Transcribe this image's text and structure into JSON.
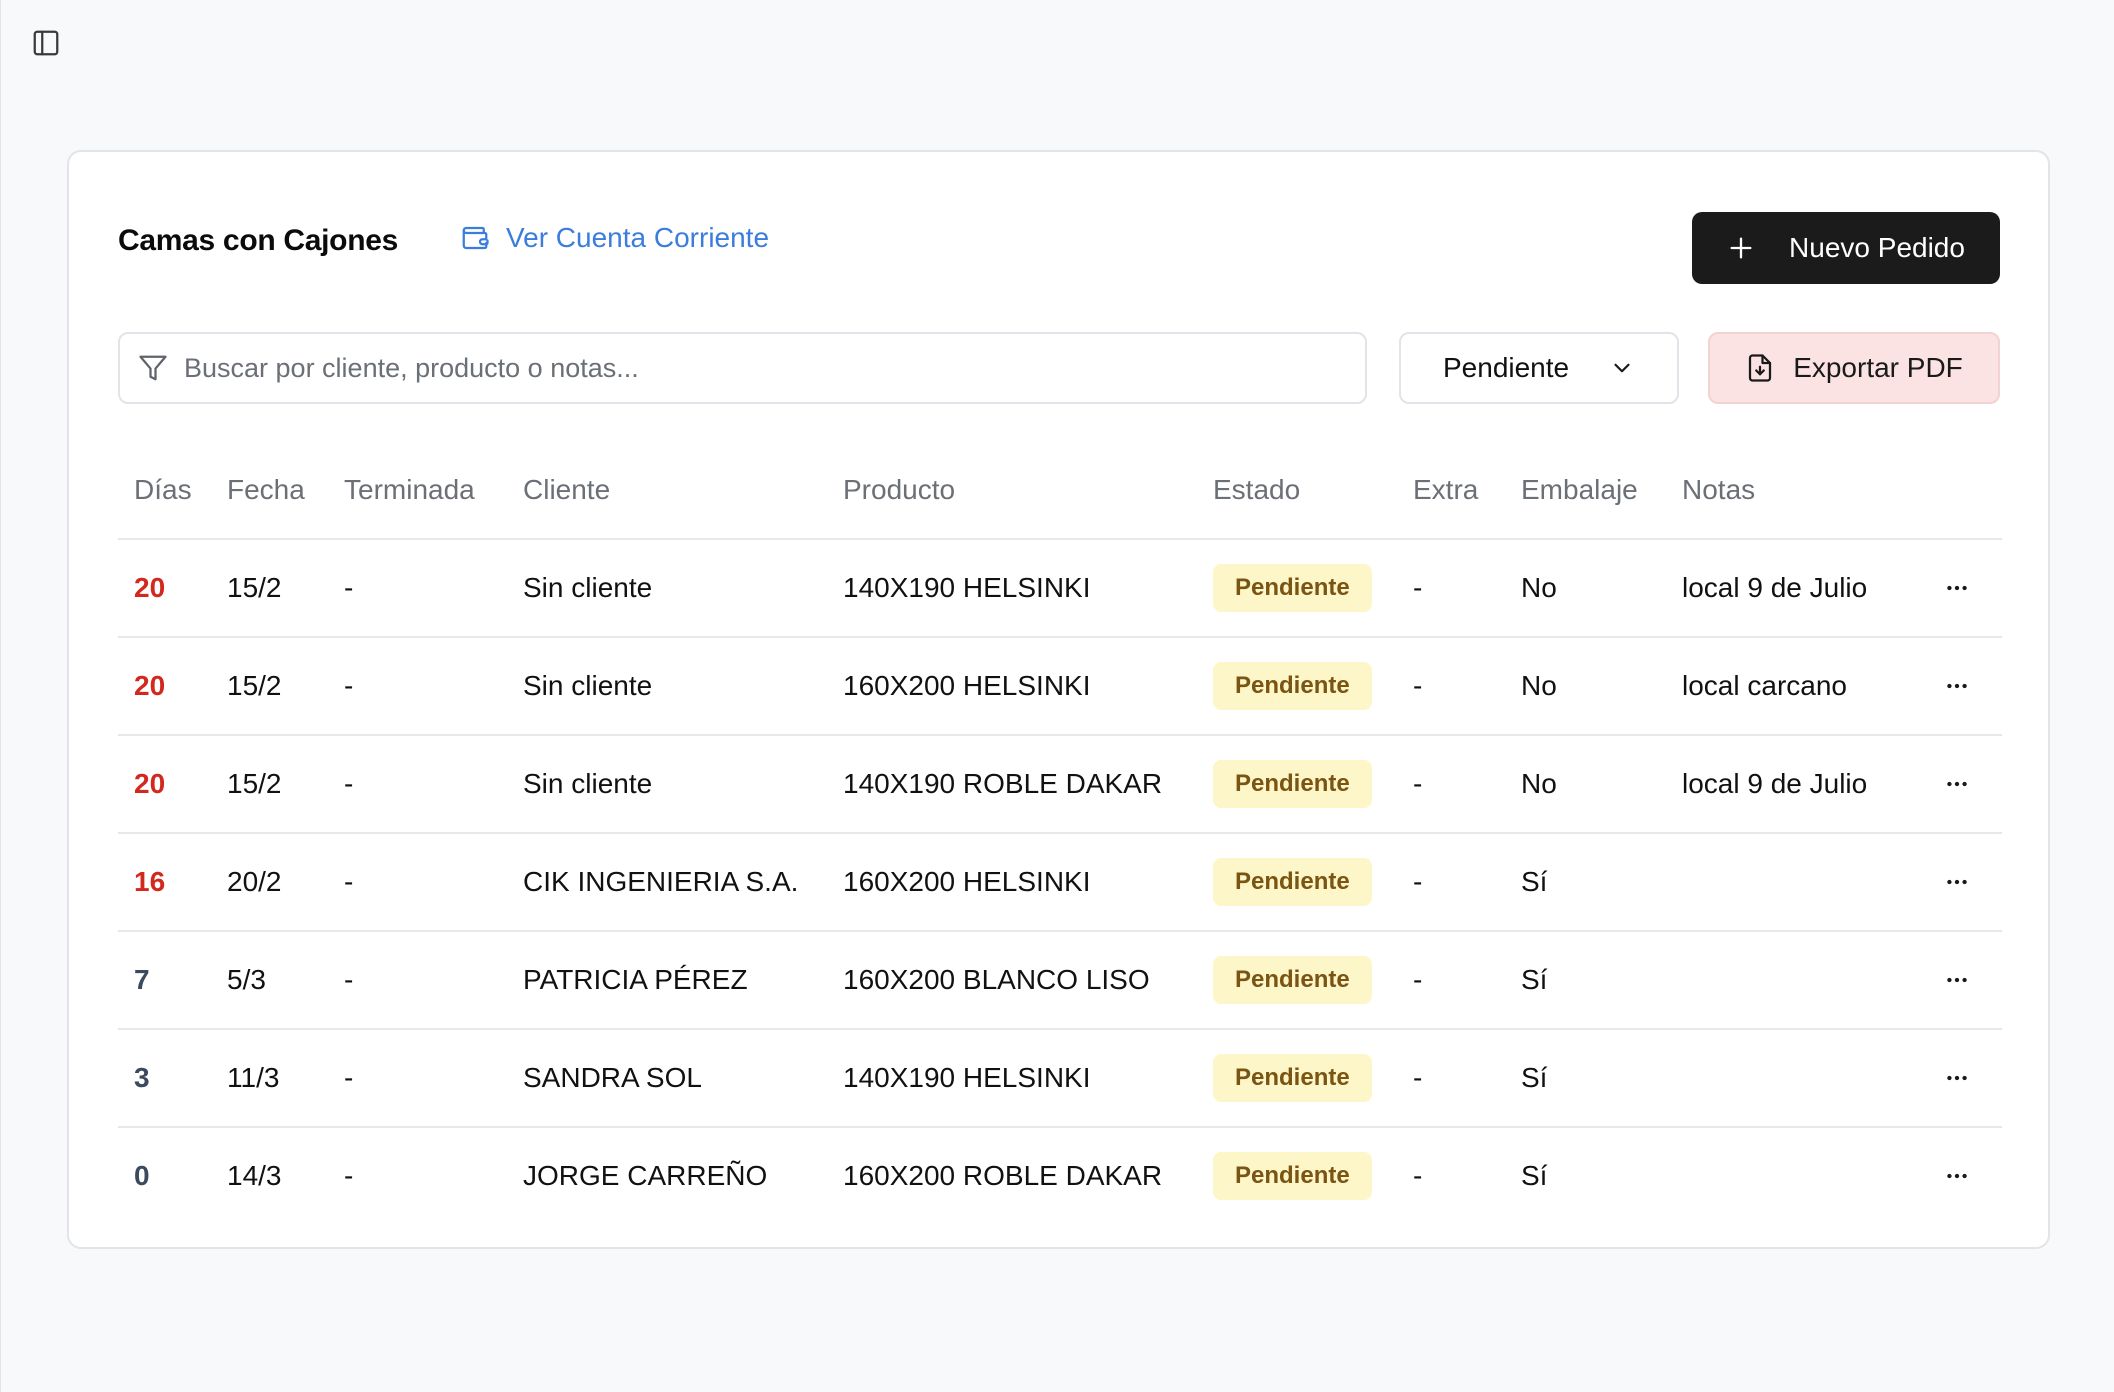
{
  "header": {
    "title": "Camas con Cajones",
    "account_link_label": "Ver Cuenta Corriente",
    "new_order_label": "Nuevo Pedido"
  },
  "filters": {
    "search_placeholder": "Buscar por cliente, producto o notas...",
    "search_value": "",
    "status_selected": "Pendiente",
    "export_label": "Exportar PDF"
  },
  "table": {
    "columns": [
      "Días",
      "Fecha",
      "Terminada",
      "Cliente",
      "Producto",
      "Estado",
      "Extra",
      "Embalaje",
      "Notas"
    ],
    "rows": [
      {
        "dias": "20",
        "fecha": "15/2",
        "terminada": "-",
        "cliente": "Sin cliente",
        "producto": "140X190 HELSINKI",
        "estado": "Pendiente",
        "extra": "-",
        "embalaje": "No",
        "notas": "local 9 de Julio",
        "urgent": true
      },
      {
        "dias": "20",
        "fecha": "15/2",
        "terminada": "-",
        "cliente": "Sin cliente",
        "producto": "160X200 HELSINKI",
        "estado": "Pendiente",
        "extra": "-",
        "embalaje": "No",
        "notas": "local carcano",
        "urgent": true
      },
      {
        "dias": "20",
        "fecha": "15/2",
        "terminada": "-",
        "cliente": "Sin cliente",
        "producto": "140X190 ROBLE DAKAR",
        "estado": "Pendiente",
        "extra": "-",
        "embalaje": "No",
        "notas": "local 9 de Julio",
        "urgent": true
      },
      {
        "dias": "16",
        "fecha": "20/2",
        "terminada": "-",
        "cliente": "CIK INGENIERIA S.A.",
        "producto": "160X200 HELSINKI",
        "estado": "Pendiente",
        "extra": "-",
        "embalaje": "Sí",
        "notas": "",
        "urgent": true
      },
      {
        "dias": "7",
        "fecha": "5/3",
        "terminada": "-",
        "cliente": "PATRICIA PÉREZ",
        "producto": "160X200 BLANCO LISO",
        "estado": "Pendiente",
        "extra": "-",
        "embalaje": "Sí",
        "notas": "",
        "urgent": false
      },
      {
        "dias": "3",
        "fecha": "11/3",
        "terminada": "-",
        "cliente": "SANDRA SOL",
        "producto": "140X190 HELSINKI",
        "estado": "Pendiente",
        "extra": "-",
        "embalaje": "Sí",
        "notas": "",
        "urgent": false
      },
      {
        "dias": "0",
        "fecha": "14/3",
        "terminada": "-",
        "cliente": "JORGE CARREÑO",
        "producto": "160X200 ROBLE DAKAR",
        "estado": "Pendiente",
        "extra": "-",
        "embalaje": "Sí",
        "notas": "",
        "urgent": false
      }
    ]
  },
  "icons": {
    "sidebar_toggle": "panel-left-icon",
    "account": "wallet-icon",
    "new_order": "plus-icon",
    "search": "filter-icon",
    "select": "chevron-down-icon",
    "export": "file-download-icon",
    "row_menu": "more-horizontal-icon"
  },
  "colors": {
    "urgent_days": "#d2281e",
    "normal_days": "#3b4a5e",
    "link": "#3b7ddd",
    "primary_button": "#1c1b1b",
    "export_button": "#fbe3e3",
    "badge_bg": "#fdf6c8",
    "badge_text": "#7a5412"
  }
}
